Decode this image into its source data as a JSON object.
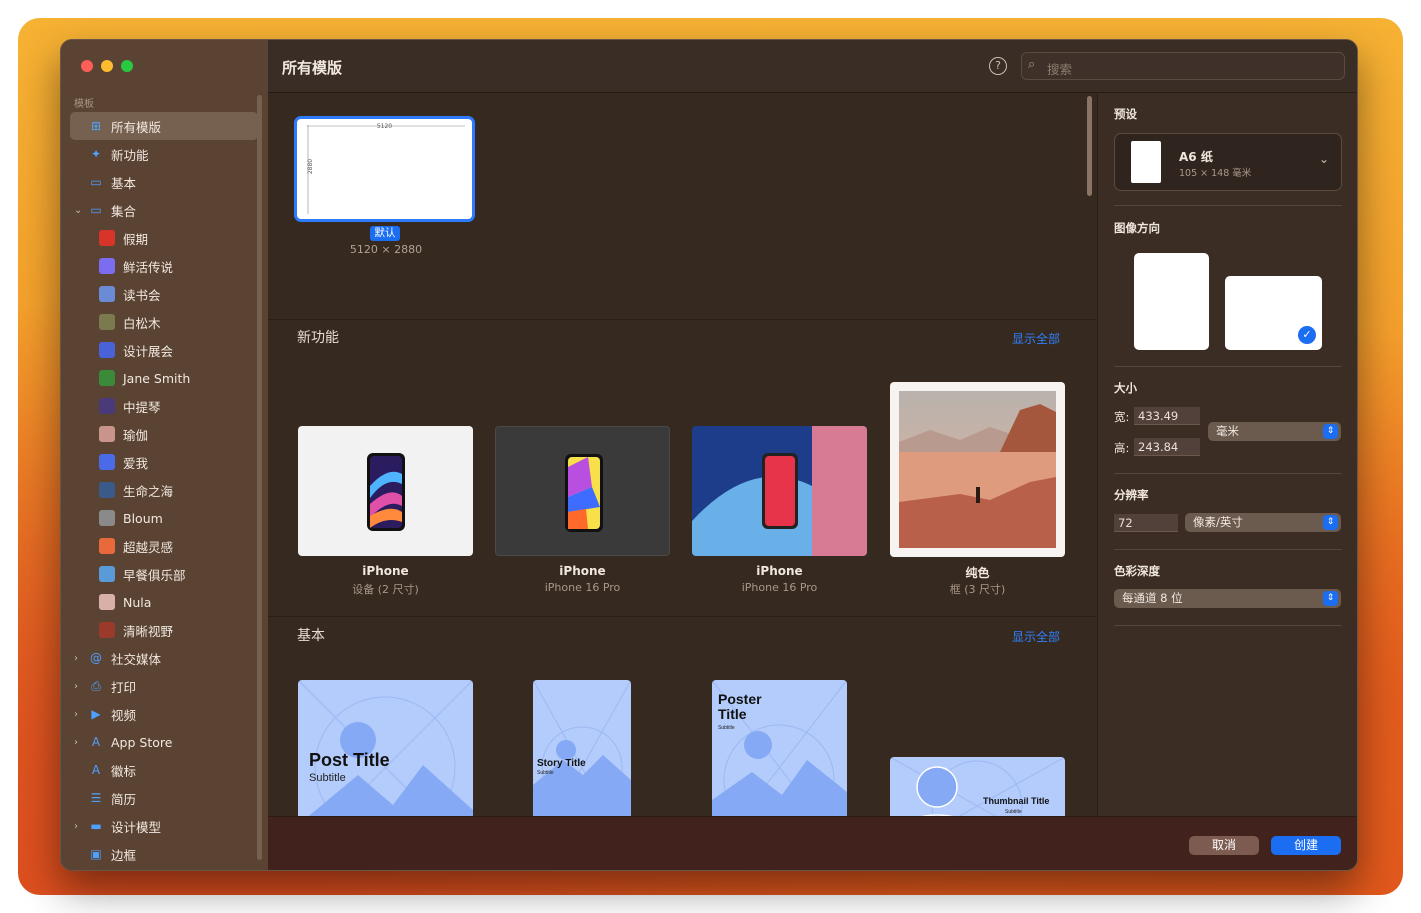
{
  "window": {
    "title": "所有模版"
  },
  "search": {
    "placeholder": "搜索"
  },
  "help_icon": "?",
  "sidebar": {
    "section_label": "模板",
    "items": [
      {
        "label": "所有模版",
        "icon": "grid-icon",
        "glyph": "⊞",
        "level": 0,
        "selected": true
      },
      {
        "label": "新功能",
        "icon": "sparkle-icon",
        "glyph": "✦",
        "level": 0
      },
      {
        "label": "基本",
        "icon": "rectangle-icon",
        "glyph": "▭",
        "level": 0
      },
      {
        "label": "集合",
        "icon": "collection-icon",
        "glyph": "▭",
        "level": 0,
        "chevron": "⌄"
      },
      {
        "label": "假期",
        "icon": "thumb-holiday",
        "thumb": "#d8342a",
        "level": 1
      },
      {
        "label": "鲜活传说",
        "icon": "thumb-legend",
        "thumb": "#7b6cf0",
        "level": 1
      },
      {
        "label": "读书会",
        "icon": "thumb-bookclub",
        "thumb": "#6b8bd6",
        "level": 1
      },
      {
        "label": "白松木",
        "icon": "thumb-pine",
        "thumb": "#7a7a4e",
        "level": 1
      },
      {
        "label": "设计展会",
        "icon": "thumb-design-expo",
        "thumb": "#4a62d8",
        "level": 1
      },
      {
        "label": "Jane Smith",
        "icon": "thumb-jane-smith",
        "thumb": "#3a8a3a",
        "level": 1
      },
      {
        "label": "中提琴",
        "icon": "thumb-viola",
        "thumb": "#4a3a7a",
        "level": 1
      },
      {
        "label": "瑜伽",
        "icon": "thumb-yoga",
        "thumb": "#c9958a",
        "level": 1
      },
      {
        "label": "爱我",
        "icon": "thumb-love-me",
        "thumb": "#4a6ae8",
        "level": 1
      },
      {
        "label": "生命之海",
        "icon": "thumb-sea-of-life",
        "thumb": "#3a5a8a",
        "level": 1
      },
      {
        "label": "Bloum",
        "icon": "thumb-bloum",
        "thumb": "#8a8a8a",
        "level": 1
      },
      {
        "label": "超越灵感",
        "icon": "thumb-inspiration",
        "thumb": "#e86a3a",
        "level": 1
      },
      {
        "label": "早餐俱乐部",
        "icon": "thumb-breakfast-club",
        "thumb": "#5a9ad8",
        "level": 1
      },
      {
        "label": "Nula",
        "icon": "thumb-nula",
        "thumb": "#d8b0a8",
        "level": 1
      },
      {
        "label": "清晰视野",
        "icon": "thumb-clear-vision",
        "thumb": "#9a3a2a",
        "level": 1
      },
      {
        "label": "社交媒体",
        "icon": "at-icon",
        "glyph": "@",
        "level": 0,
        "chevron": "›"
      },
      {
        "label": "打印",
        "icon": "printer-icon",
        "glyph": "⎙",
        "level": 0,
        "chevron": "›"
      },
      {
        "label": "视频",
        "icon": "video-icon",
        "glyph": "▶",
        "level": 0,
        "chevron": "›"
      },
      {
        "label": "App Store",
        "icon": "app-store-icon",
        "glyph": "A",
        "level": 0,
        "chevron": "›"
      },
      {
        "label": "徽标",
        "icon": "logo-icon",
        "glyph": "A",
        "level": 0
      },
      {
        "label": "简历",
        "icon": "document-icon",
        "glyph": "☰",
        "level": 0
      },
      {
        "label": "设计模型",
        "icon": "mockup-icon",
        "glyph": "▬",
        "level": 0,
        "chevron": "›"
      },
      {
        "label": "边框",
        "icon": "frame-icon",
        "glyph": "▣",
        "level": 0
      }
    ]
  },
  "default_template": {
    "badge": "默认",
    "size": "5120 × 2880",
    "width_label": "5120",
    "height_label": "2880"
  },
  "sections": {
    "new": {
      "title": "新功能",
      "show_all": "显示全部",
      "cards": [
        {
          "name": "iPhone",
          "sub": "设备 (2 尺寸)"
        },
        {
          "name": "iPhone",
          "sub": "iPhone 16 Pro"
        },
        {
          "name": "iPhone",
          "sub": "iPhone 16 Pro"
        },
        {
          "name": "纯色",
          "sub": "框 (3 尺寸)"
        }
      ]
    },
    "basic": {
      "title": "基本",
      "show_all": "显示全部",
      "cards": [
        {
          "title": "Post Title",
          "subtitle": "Subtitle"
        },
        {
          "title": "Story Title",
          "subtitle": "Subtitle"
        },
        {
          "title": "Poster Title",
          "subtitle": "Subtitle"
        },
        {
          "title": "Thumbnail Title",
          "subtitle": "Subtitle"
        }
      ]
    }
  },
  "panel": {
    "preset_label": "预设",
    "preset": {
      "name": "A6 纸",
      "size": "105 × 148 毫米"
    },
    "orientation_label": "图像方向",
    "orientation": "landscape",
    "size_label": "大小",
    "width_label": "宽:",
    "width_value": "433.49",
    "height_label": "高:",
    "height_value": "243.84",
    "unit": "毫米",
    "resolution_label": "分辨率",
    "resolution_value": "72",
    "resolution_unit": "像素/英寸",
    "color_depth_label": "色彩深度",
    "color_depth_value": "每通道 8 位"
  },
  "footer": {
    "cancel": "取消",
    "create": "创建"
  },
  "colors": {
    "accent": "#1b6df2",
    "link": "#2f80ff"
  }
}
